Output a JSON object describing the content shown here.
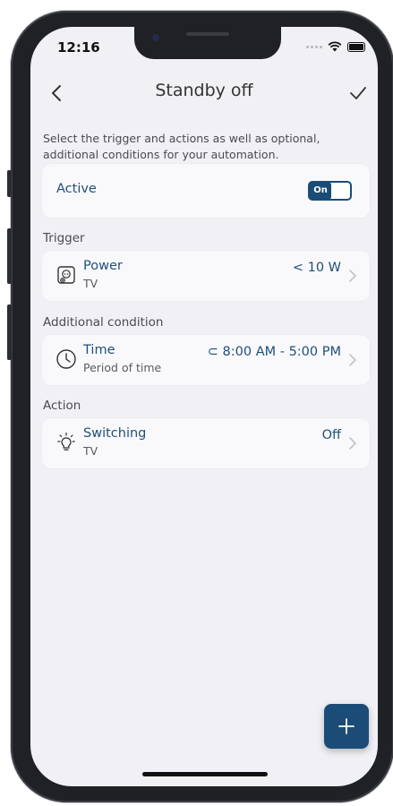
{
  "status_bar": {
    "time": "12:16"
  },
  "nav": {
    "title": "Standby off"
  },
  "intro_text": "Select the trigger and actions as well as optional, additional conditions for your automation.",
  "active": {
    "label": "Active",
    "toggle_text": "On",
    "enabled": true
  },
  "sections": {
    "trigger": "Trigger",
    "condition": "Additional condition",
    "action": "Action"
  },
  "trigger_row": {
    "icon": "power-socket-icon",
    "title": "Power",
    "subtitle": "TV",
    "value": "< 10 W"
  },
  "condition_row": {
    "icon": "clock-icon",
    "title": "Time",
    "subtitle": "Period of time",
    "value": "⊂ 8:00 AM - 5:00 PM"
  },
  "action_row": {
    "icon": "lightbulb-icon",
    "title": "Switching",
    "subtitle": "TV",
    "value": "Off"
  },
  "fab": {
    "icon": "plus-icon"
  },
  "colors": {
    "accent": "#1b4c78",
    "text_blue": "#1f4f7a",
    "background": "#f1f1f5"
  }
}
